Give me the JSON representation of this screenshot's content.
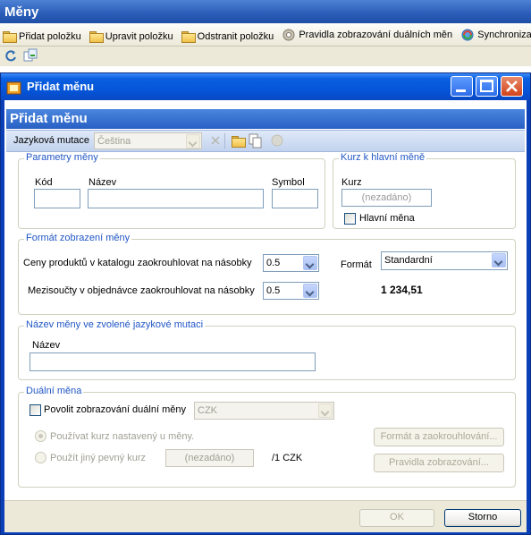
{
  "app": {
    "title": "Měny",
    "toolbar": [
      {
        "label": "Přidat položku",
        "icon": "add-folder-icon"
      },
      {
        "label": "Upravit položku",
        "icon": "edit-folder-icon"
      },
      {
        "label": "Odstranit položku",
        "icon": "delete-folder-icon"
      },
      {
        "label": "Pravidla zobrazování duálních měn",
        "icon": "gear-icon"
      },
      {
        "label": "Synchronizace m",
        "icon": "sync-icon"
      }
    ]
  },
  "dialog": {
    "title": "Přidat měnu",
    "header_title": "Přidat měnu",
    "language_label": "Jazyková mutace",
    "language_value": "Čeština",
    "params": {
      "legend": "Parametry měny",
      "code_label": "Kód",
      "name_label": "Název",
      "symbol_label": "Symbol"
    },
    "rate": {
      "legend": "Kurz k hlavní měně",
      "rate_label": "Kurz",
      "rate_placeholder": "(nezadáno)",
      "main_currency_label": "Hlavní měna"
    },
    "format": {
      "legend": "Formát zobrazení měny",
      "catalog_label": "Ceny produktů v katalogu  zaokrouhlovat na násobky",
      "catalog_value": "0.5",
      "order_label": "Mezisoučty v objednávce zaokrouhlovat na násobky",
      "order_value": "0.5",
      "format_label": "Formát",
      "format_value": "Standardní",
      "preview": "1 234,51"
    },
    "lang_name": {
      "legend": "Název měny ve zvolené jazykové mutaci",
      "name_label": "Název"
    },
    "dual": {
      "legend": "Duální měna",
      "enable_label": "Povolit zobrazování duální měny",
      "currency_value": "CZK",
      "option_rate_label": "Používat kurz nastavený u měny.",
      "option_fixed_label": "Použít jiný pevný kurz",
      "fixed_placeholder": "(nezadáno)",
      "fixed_suffix": "/1 CZK",
      "format_button": "Formát a zaokrouhlování...",
      "rules_button": "Pravidla zobrazování..."
    },
    "ok_button": "OK",
    "cancel_button": "Storno"
  }
}
